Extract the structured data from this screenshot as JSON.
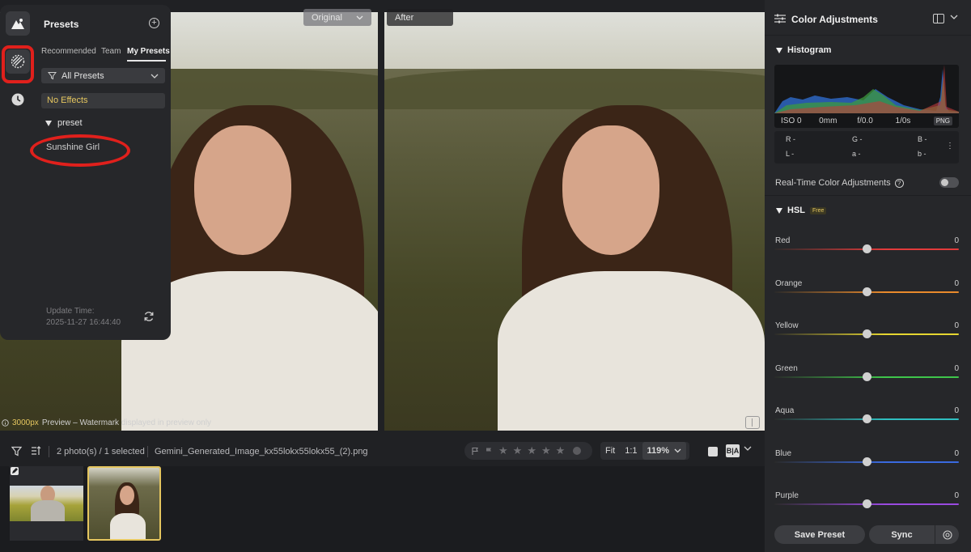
{
  "canvas": {
    "before_label": "Original",
    "after_label": "After",
    "watermark_resolution": "3000px",
    "watermark_text": "Preview – Watermark displayed in preview only"
  },
  "presets_panel": {
    "title": "Presets",
    "tabs": [
      "Recommended",
      "Team",
      "My Presets"
    ],
    "active_tab": "My Presets",
    "filter_value": "All Presets",
    "no_effects_label": "No Effects",
    "group_name": "preset",
    "items": [
      "Sunshine Girl"
    ],
    "update_label": "Update Time:",
    "update_time": "2025-11-27 16:44:40"
  },
  "bottom_bar": {
    "photo_count": "2 photo(s) / 1 selected",
    "file_name": "Gemini_Generated_Image_kx55lokx55lokx55_(2).png",
    "zoom_fit": "Fit",
    "zoom_1to1": "1:1",
    "zoom_level": "119%",
    "ba_label": "B|A"
  },
  "right_panel": {
    "title": "Color Adjustments",
    "histogram_title": "Histogram",
    "exif": [
      "ISO 0",
      "0mm",
      "f/0.0",
      "1/0s"
    ],
    "format_badge": "PNG",
    "readout": {
      "r": "R -",
      "g": "G -",
      "b": "B -",
      "l": "L -",
      "a": "a -",
      "b2": "b -"
    },
    "realtime_label": "Real-Time Color Adjustments",
    "realtime_on": false,
    "hsl_title": "HSL",
    "hsl_badge": "Free",
    "hsl": [
      {
        "name": "Red",
        "value": "0",
        "color": "#e23b3b"
      },
      {
        "name": "Orange",
        "value": "0",
        "color": "#e98a2c"
      },
      {
        "name": "Yellow",
        "value": "0",
        "color": "#e6d631"
      },
      {
        "name": "Green",
        "value": "0",
        "color": "#3fc64b"
      },
      {
        "name": "Aqua",
        "value": "0",
        "color": "#2fbfc0"
      },
      {
        "name": "Blue",
        "value": "0",
        "color": "#3a6ae0"
      },
      {
        "name": "Purple",
        "value": "0",
        "color": "#9a4ae0"
      }
    ],
    "save_preset_label": "Save Preset",
    "sync_label": "Sync"
  },
  "colors": {
    "accent": "#e5c65f",
    "annotation_red": "#e0201c"
  }
}
